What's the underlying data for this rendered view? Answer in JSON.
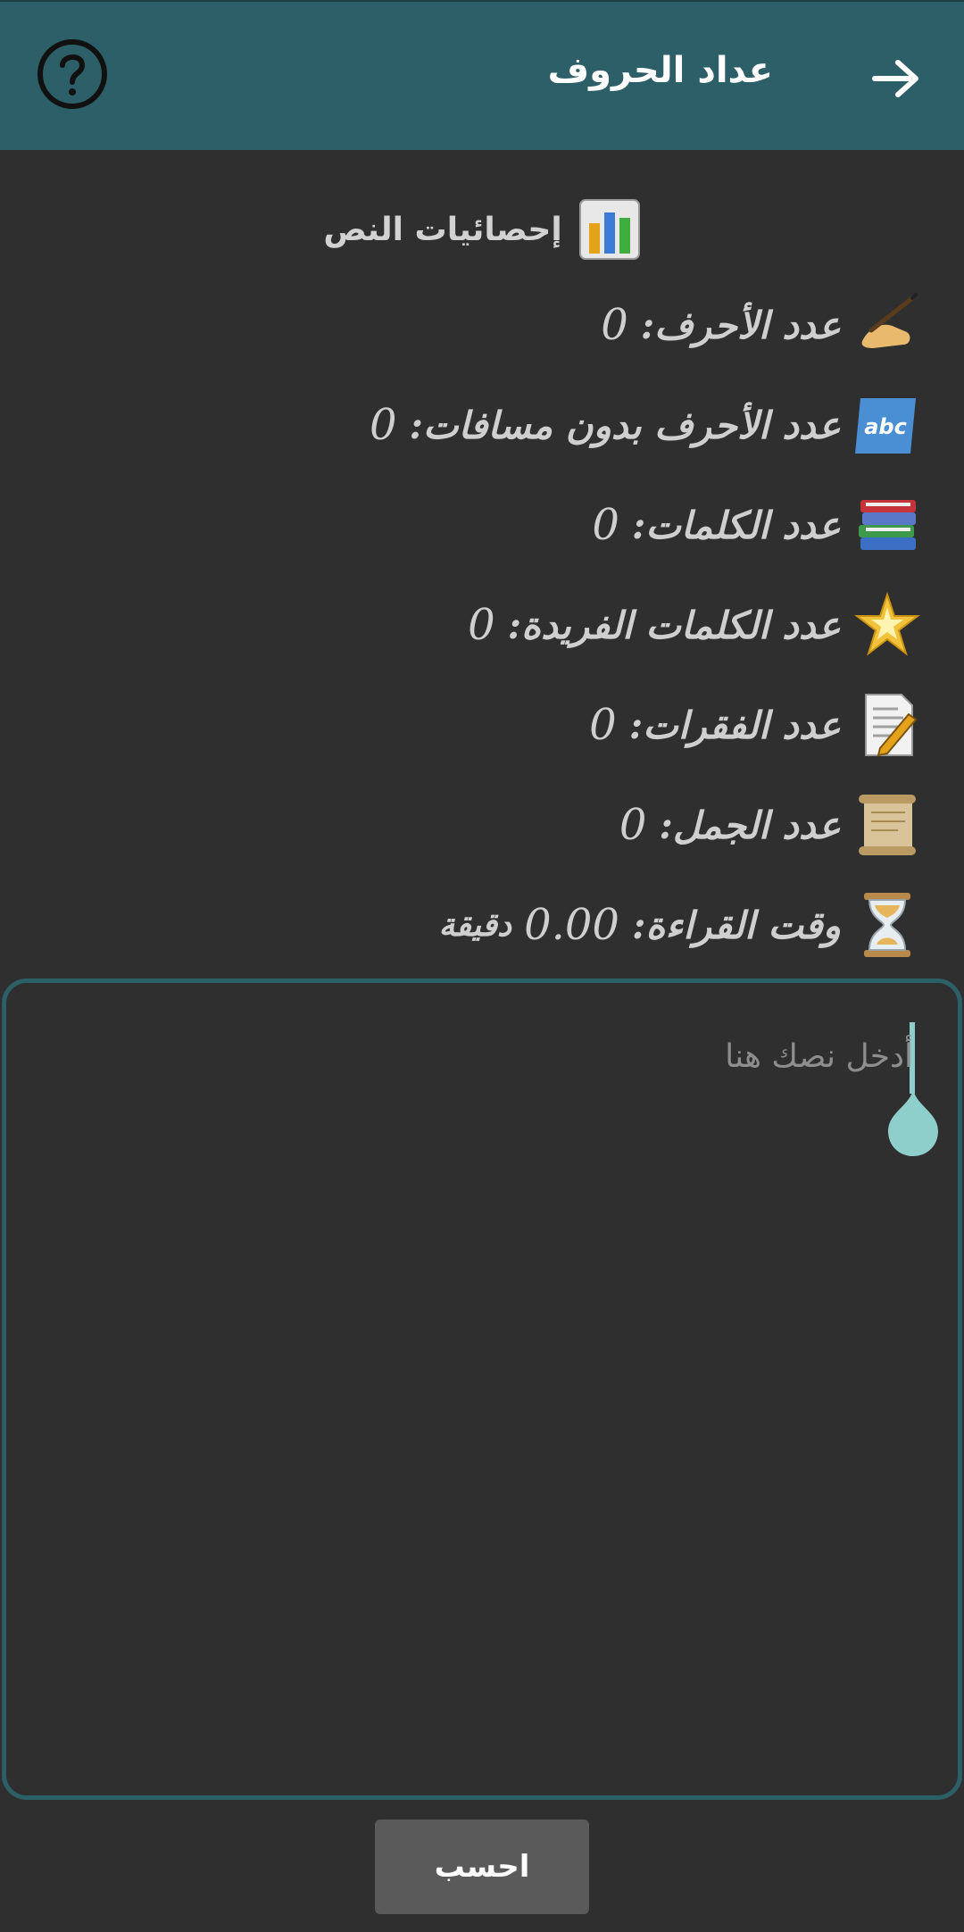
{
  "header": {
    "title": "عداد الحروف",
    "back_icon": "arrow-right-icon",
    "help_icon": "help-circle-icon",
    "bg_color": "#2c5f67"
  },
  "stats": {
    "heading": "إحصائيات النص",
    "heading_icon": "bar-chart-icon",
    "items": [
      {
        "label": "عدد الأحرف:",
        "value": "0",
        "icon": "writing-hand-icon"
      },
      {
        "label": "عدد الأحرف بدون مسافات:",
        "value": "0",
        "icon": "abc-icon"
      },
      {
        "label": "عدد الكلمات:",
        "value": "0",
        "icon": "books-icon"
      },
      {
        "label": "عدد الكلمات الفريدة:",
        "value": "0",
        "icon": "sparkle-star-icon"
      },
      {
        "label": "عدد الفقرات:",
        "value": "0",
        "icon": "document-pencil-icon"
      },
      {
        "label": "عدد الجمل:",
        "value": "0",
        "icon": "scroll-icon"
      },
      {
        "label": "وقت القراءة:",
        "value": "0.00",
        "unit": "دقيقة",
        "icon": "hourglass-icon"
      }
    ]
  },
  "input": {
    "placeholder": "أدخل نصك هنا",
    "value": "",
    "accent_color": "#8ecfcb"
  },
  "actions": {
    "calculate_label": "احسب"
  }
}
